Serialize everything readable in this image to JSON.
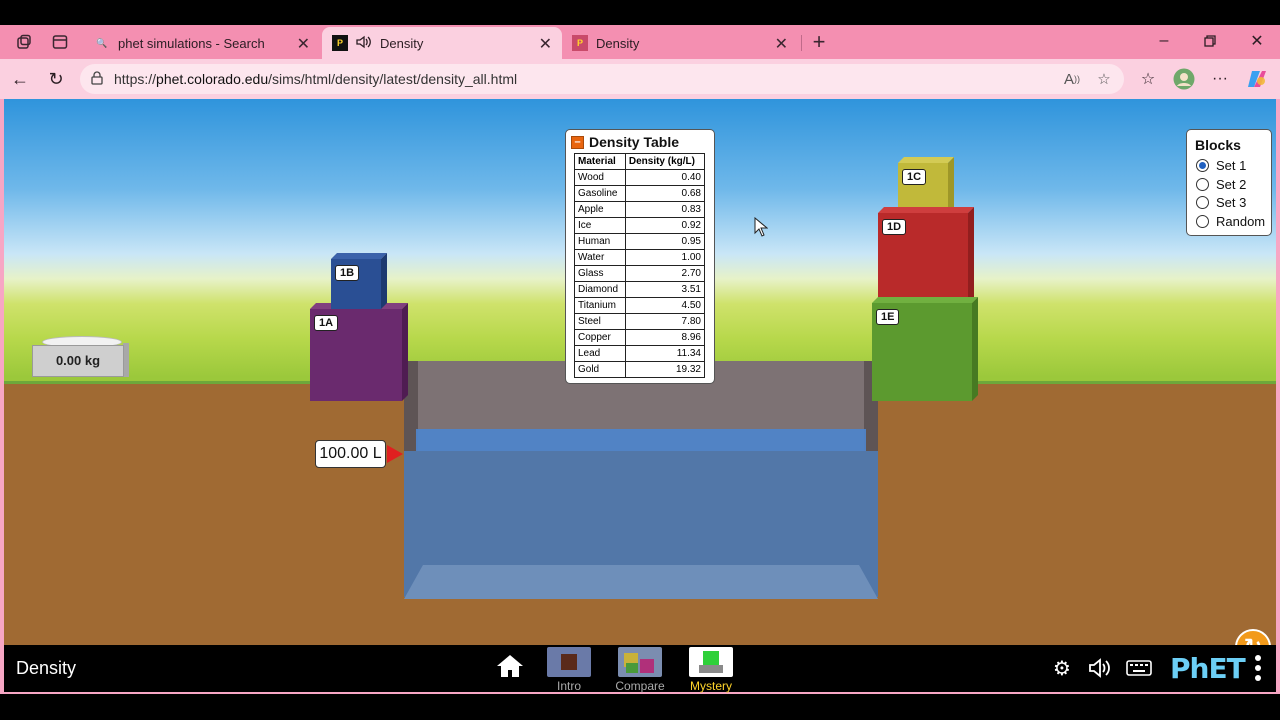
{
  "browser": {
    "tabs": [
      {
        "title": "phet simulations - Search",
        "favicon": "search-icon"
      },
      {
        "title": "Density",
        "favicon": "phet-icon",
        "audio": true
      },
      {
        "title": "Density",
        "favicon": "phet-icon"
      }
    ],
    "url_prefix": "https://",
    "url_domain": "phet.colorado.edu",
    "url_path": "/sims/html/density/latest/density_all.html"
  },
  "sim": {
    "scale_reading": "0.00 kg",
    "volume_reading": "100.00 L",
    "blocks": [
      {
        "id": "1A",
        "color": "#6a2a6e"
      },
      {
        "id": "1B",
        "color": "#2a4f94"
      },
      {
        "id": "1C",
        "color": "#c1b93a"
      },
      {
        "id": "1D",
        "color": "#b92a2a"
      },
      {
        "id": "1E",
        "color": "#5c9a2f"
      }
    ],
    "density_table": {
      "title": "Density Table",
      "headers": [
        "Material",
        "Density (kg/L)"
      ],
      "rows": [
        [
          "Wood",
          "0.40"
        ],
        [
          "Gasoline",
          "0.68"
        ],
        [
          "Apple",
          "0.83"
        ],
        [
          "Ice",
          "0.92"
        ],
        [
          "Human",
          "0.95"
        ],
        [
          "Water",
          "1.00"
        ],
        [
          "Glass",
          "2.70"
        ],
        [
          "Diamond",
          "3.51"
        ],
        [
          "Titanium",
          "4.50"
        ],
        [
          "Steel",
          "7.80"
        ],
        [
          "Copper",
          "8.96"
        ],
        [
          "Lead",
          "11.34"
        ],
        [
          "Gold",
          "19.32"
        ]
      ]
    },
    "blocks_panel": {
      "title": "Blocks",
      "options": [
        "Set 1",
        "Set 2",
        "Set 3",
        "Random"
      ],
      "selected": "Set 1"
    }
  },
  "navbar": {
    "title": "Density",
    "screens": [
      {
        "label": "Intro"
      },
      {
        "label": "Compare"
      },
      {
        "label": "Mystery",
        "selected": true
      }
    ],
    "logo": "PhET"
  }
}
